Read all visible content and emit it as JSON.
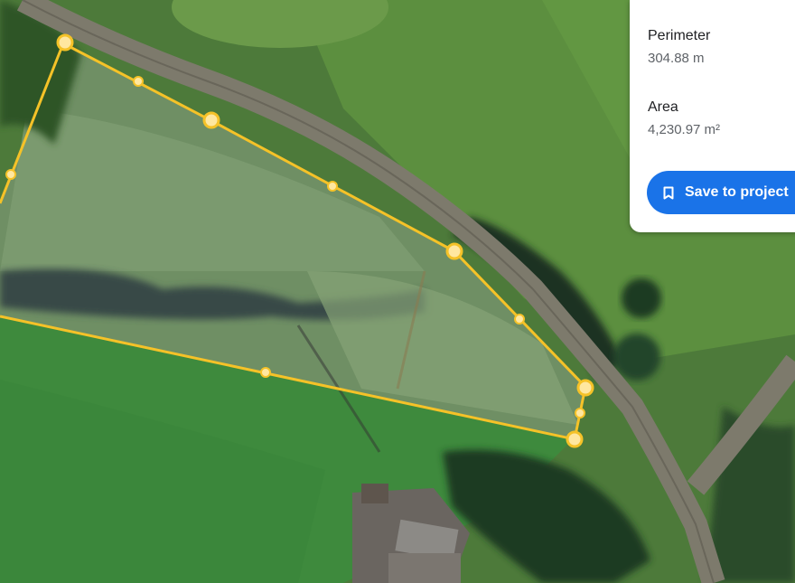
{
  "measurement": {
    "perimeter_label": "Perimeter",
    "perimeter_value": "304.88 m",
    "area_label": "Area",
    "area_value": "4,230.97 m²",
    "save_label": "Save to project"
  },
  "icons": {
    "save": "bookmark-icon"
  },
  "colors": {
    "outline": "#f5c228",
    "vertex": "#ffe7a0",
    "save_button": "#1a73e8"
  }
}
